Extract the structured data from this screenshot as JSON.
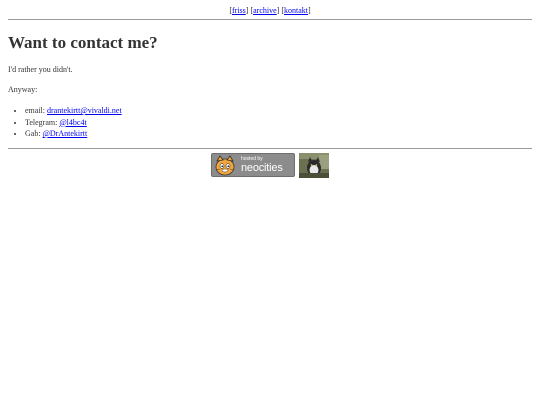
{
  "nav": {
    "open": "[",
    "close": "]",
    "sep": " ",
    "items": [
      {
        "label": "friss"
      },
      {
        "label": "archive"
      },
      {
        "label": "kontakt"
      }
    ]
  },
  "main": {
    "title": "Want to contact me?",
    "intro": "I'd rather you didn't.",
    "anyway": "Anyway:",
    "contacts": [
      {
        "label": "email: ",
        "link": "drantekirtt@vivaldi.net"
      },
      {
        "label": "Telegram: ",
        "link": "@l4bc4t"
      },
      {
        "label": "Gab: ",
        "link": "@DrAntekirtt"
      }
    ]
  },
  "footer": {
    "badge_small": "hosted by",
    "badge_large": "neocities",
    "icons": {
      "neocities": "neocities-cat-icon",
      "photo": "cat-photo-icon"
    }
  },
  "colors": {
    "link": "#0000ee",
    "text": "#333333",
    "rule": "#9a9a9a"
  }
}
